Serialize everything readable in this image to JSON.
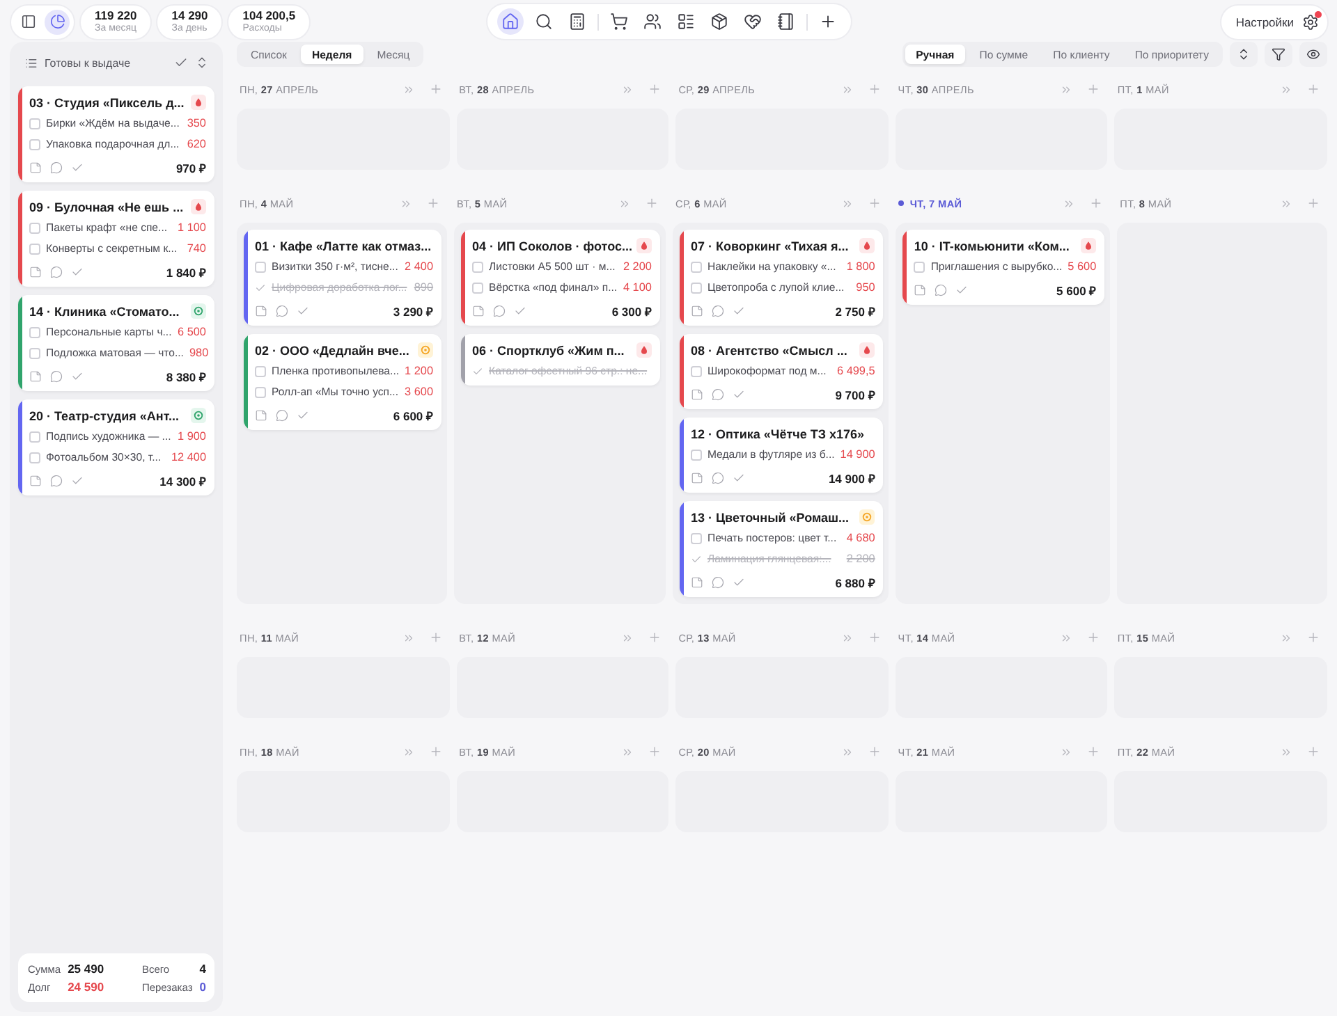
{
  "toolbar": {
    "panel_toggles": [
      {
        "kind": "sidebar",
        "selected": false
      },
      {
        "kind": "chart",
        "selected": true
      }
    ],
    "stats": [
      {
        "value": "119 220",
        "label": "За месяц"
      },
      {
        "value": "14 290",
        "label": "За день"
      },
      {
        "value": "104 200,5",
        "label": "Расходы"
      }
    ],
    "nav": [
      {
        "items": [
          {
            "kind": "home",
            "selected": true
          },
          {
            "kind": "search",
            "selected": false
          },
          {
            "kind": "calculator",
            "selected": false
          }
        ]
      },
      {
        "items": [
          {
            "kind": "cart",
            "selected": false
          },
          {
            "kind": "users",
            "selected": false
          },
          {
            "kind": "list",
            "selected": false
          },
          {
            "kind": "box",
            "selected": false
          },
          {
            "kind": "handshake",
            "selected": false
          },
          {
            "kind": "notebook",
            "selected": false
          }
        ]
      },
      {
        "items": [
          {
            "kind": "add",
            "selected": false
          }
        ]
      }
    ],
    "settings": {
      "label": "Настройки",
      "notification": true
    }
  },
  "sidebar": {
    "title": "Готовы к выдаче",
    "orders": [
      {
        "kind": "urgent",
        "title": "03 · Студия «Пиксель д...",
        "color": "#e5484d",
        "items": [
          {
            "text": "Бирки «Ждём на выдаче...",
            "price": "350",
            "checked": false
          },
          {
            "text": "Упаковка подарочная дл...",
            "price": "620",
            "checked": false
          }
        ],
        "total": "970 ₽"
      },
      {
        "kind": "urgent",
        "title": "09 · Булочная «Не ешь ...",
        "color": "#e5484d",
        "items": [
          {
            "text": "Пакеты крафт «не спе...",
            "price": "1 100",
            "checked": false
          },
          {
            "text": "Конверты с секретным к...",
            "price": "740",
            "checked": false
          }
        ],
        "total": "1 840 ₽"
      },
      {
        "kind": "low",
        "title": "14 · Клиника «Стомато...",
        "color": "#30a46c",
        "items": [
          {
            "text": "Персональные карты ч...",
            "price": "6 500",
            "checked": false
          },
          {
            "text": "Подложка матовая — что...",
            "price": "980",
            "checked": false
          }
        ],
        "total": "8 380 ₽"
      },
      {
        "kind": "low",
        "title": "20 · Театр-студия «Ант...",
        "color": "#6366f1",
        "items": [
          {
            "text": "Подпись художника — ...",
            "price": "1 900",
            "checked": false
          },
          {
            "text": "Фотоальбом 30×30, т...",
            "price": "12 400",
            "checked": false
          }
        ],
        "total": "14 300 ₽"
      }
    ],
    "summary": [
      {
        "label": "Сумма",
        "value": "25 490",
        "color": "#1c1c1e"
      },
      {
        "label": "Всего",
        "value": "4",
        "color": "#1c1c1e"
      },
      {
        "label": "Долг",
        "value": "24 590",
        "color": "#e5484d"
      },
      {
        "label": "Перезаказ",
        "value": "0",
        "color": "#5b5bd6"
      }
    ]
  },
  "view_tabs": [
    {
      "label": "Список",
      "selected": false
    },
    {
      "label": "Неделя",
      "selected": true
    },
    {
      "label": "Месяц",
      "selected": false
    }
  ],
  "sort_tabs": [
    {
      "label": "Ручная",
      "selected": true
    },
    {
      "label": "По сумме",
      "selected": false
    },
    {
      "label": "По клиенту",
      "selected": false
    },
    {
      "label": "По приоритету",
      "selected": false
    }
  ],
  "weeks": [
    {
      "days": [
        {
          "label": "ПН, **27** АПРЕЛЬ",
          "today": false
        },
        {
          "label": "ВТ, **28** АПРЕЛЬ",
          "today": false
        },
        {
          "label": "СР, **29** АПРЕЛЬ",
          "today": false
        },
        {
          "label": "ЧТ, **30** АПРЕЛЬ",
          "today": false
        },
        {
          "label": "ПТ, **1** МАЙ",
          "today": false
        }
      ]
    },
    {
      "days": [
        {
          "label": "ПН, **4** МАЙ",
          "today": false,
          "orders": [
            {
              "kind": "plain",
              "title": "01 · Кафе «Латте как отмаз...",
              "color": "#6366f1",
              "items": [
                {
                  "text": "Визитки 350 г·м², тисне...",
                  "price": "2 400",
                  "checked": false
                },
                {
                  "text": "Цифровая доработка лог...",
                  "price": "890",
                  "checked": true
                }
              ],
              "total": "3 290 ₽"
            },
            {
              "kind": "medium",
              "title": "02 · ООО «Дедлайн вче...",
              "color": "#30a46c",
              "items": [
                {
                  "text": "Пленка противопылева...",
                  "price": "1 200",
                  "checked": false
                },
                {
                  "text": "Ролл-ап «Мы точно усп...",
                  "price": "3 600",
                  "checked": false
                }
              ],
              "total": "6 600 ₽"
            }
          ]
        },
        {
          "label": "ВТ, **5** МАЙ",
          "today": false,
          "orders": [
            {
              "kind": "urgent",
              "title": "04 · ИП Соколов · фотос...",
              "color": "#e5484d",
              "items": [
                {
                  "text": "Листовки А5 500 шт · м...",
                  "price": "2 200",
                  "checked": false
                },
                {
                  "text": "Вёрстка «под финал» п...",
                  "price": "4 100",
                  "checked": false
                }
              ],
              "total": "6 300 ₽"
            },
            {
              "kind": "urgent",
              "title": "06 · Спортклуб «Жим п...",
              "color": "#a1a1aa",
              "items": [
                {
                  "text": "Каталог офсетный 96 стр.: не...",
                  "checked": true
                }
              ]
            }
          ]
        },
        {
          "label": "СР, **6** МАЙ",
          "today": false,
          "orders": [
            {
              "kind": "urgent",
              "title": "07 · Коворкинг «Тихая я...",
              "color": "#e5484d",
              "items": [
                {
                  "text": "Наклейки на упаковку «...",
                  "price": "1 800",
                  "checked": false
                },
                {
                  "text": "Цветопроба с лупой клие...",
                  "price": "950",
                  "checked": false
                }
              ],
              "total": "2 750 ₽"
            },
            {
              "kind": "urgent",
              "title": "08 · Агентство «Смысл ...",
              "color": "#e5484d",
              "items": [
                {
                  "text": "Широкоформат под м...",
                  "price": "6 499,5",
                  "checked": false
                }
              ],
              "total": "9 700 ₽"
            },
            {
              "kind": "plain",
              "title": "12 · Оптика «Чётче ТЗ х176»",
              "color": "#6366f1",
              "items": [
                {
                  "text": "Медали в футляре из б...",
                  "price": "14 900",
                  "checked": false
                }
              ],
              "total": "14 900 ₽"
            },
            {
              "kind": "medium",
              "title": "13 · Цветочный «Ромаш...",
              "color": "#6366f1",
              "items": [
                {
                  "text": "Печать постеров: цвет т...",
                  "price": "4 680",
                  "checked": false
                },
                {
                  "text": "Ламинация глянцевая:...",
                  "price": "2 200",
                  "checked": true
                }
              ],
              "total": "6 880 ₽"
            }
          ]
        },
        {
          "label": "ЧТ, **7** МАЙ",
          "today": true,
          "orders": [
            {
              "kind": "urgent",
              "title": "10 · IT-комьюнити «Ком...",
              "color": "#e5484d",
              "items": [
                {
                  "text": "Приглашения с вырубко...",
                  "price": "5 600",
                  "checked": false
                }
              ],
              "total": "5 600 ₽"
            }
          ]
        },
        {
          "label": "ПТ, **8** МАЙ",
          "today": false
        }
      ]
    },
    {
      "days": [
        {
          "label": "ПН, **11** МАЙ",
          "today": false
        },
        {
          "label": "ВТ, **12** МАЙ",
          "today": false
        },
        {
          "label": "СР, **13** МАЙ",
          "today": false
        },
        {
          "label": "ЧТ, **14** МАЙ",
          "today": false
        },
        {
          "label": "ПТ, **15** МАЙ",
          "today": false
        }
      ]
    },
    {
      "days": [
        {
          "label": "ПН, **18** МАЙ",
          "today": false
        },
        {
          "label": "ВТ, **19** МАЙ",
          "today": false
        },
        {
          "label": "СР, **20** МАЙ",
          "today": false
        },
        {
          "label": "ЧТ, **21** МАЙ",
          "today": false
        },
        {
          "label": "ПТ, **22** МАЙ",
          "today": false
        }
      ]
    }
  ]
}
